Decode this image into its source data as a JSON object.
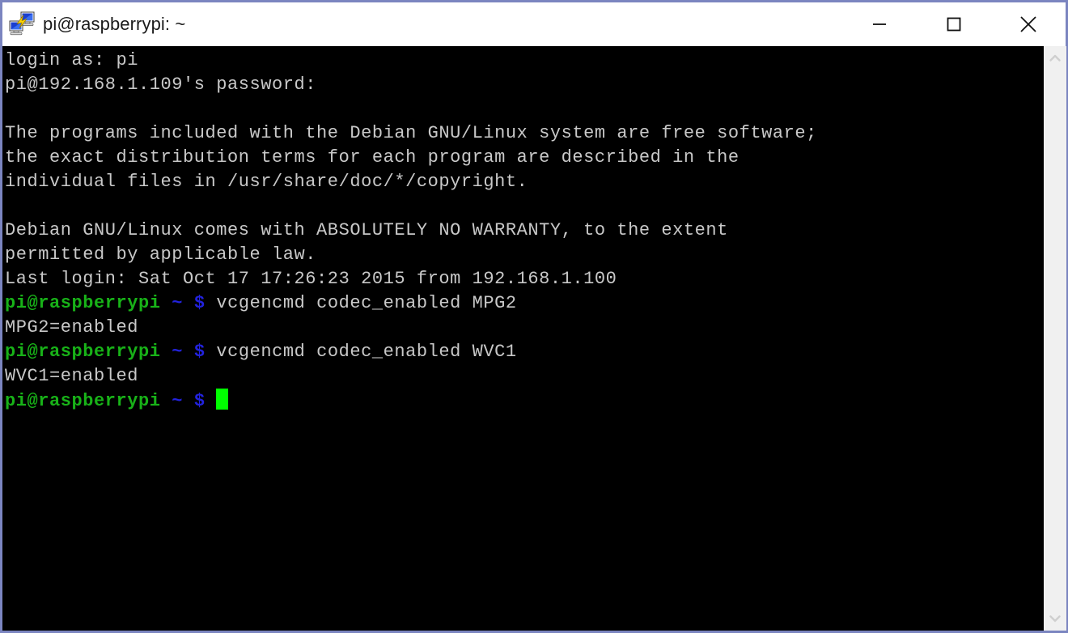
{
  "window": {
    "title": "pi@raspberrypi: ~",
    "icon": "putty-icon",
    "border_color": "#7b85c0",
    "titlebar_bg": "#ffffff",
    "controls": {
      "minimize_label": "Minimize",
      "maximize_label": "Maximize",
      "close_label": "Close"
    }
  },
  "terminal": {
    "background": "#000000",
    "foreground": "#c8c8c8",
    "prompt_user_color": "#18b218",
    "prompt_symbol_color": "#2222dd",
    "cursor_color": "#00ff00",
    "prompt_user": "pi@raspberrypi",
    "prompt_tilde": "~",
    "prompt_dollar": "$",
    "lines": [
      {
        "type": "text",
        "text": "login as: pi"
      },
      {
        "type": "text",
        "text": "pi@192.168.1.109's password:"
      },
      {
        "type": "blank",
        "text": ""
      },
      {
        "type": "text",
        "text": "The programs included with the Debian GNU/Linux system are free software;"
      },
      {
        "type": "text",
        "text": "the exact distribution terms for each program are described in the"
      },
      {
        "type": "text",
        "text": "individual files in /usr/share/doc/*/copyright."
      },
      {
        "type": "blank",
        "text": ""
      },
      {
        "type": "text",
        "text": "Debian GNU/Linux comes with ABSOLUTELY NO WARRANTY, to the extent"
      },
      {
        "type": "text",
        "text": "permitted by applicable law."
      },
      {
        "type": "text",
        "text": "Last login: Sat Oct 17 17:26:23 2015 from 192.168.1.100"
      },
      {
        "type": "prompt",
        "command": "vcgencmd codec_enabled MPG2"
      },
      {
        "type": "text",
        "text": "MPG2=enabled"
      },
      {
        "type": "prompt",
        "command": "vcgencmd codec_enabled WVC1"
      },
      {
        "type": "text",
        "text": "WVC1=enabled"
      },
      {
        "type": "prompt-cursor",
        "command": ""
      }
    ]
  },
  "scrollbar": {
    "up_icon": "chevron-up-icon",
    "down_icon": "chevron-down-icon",
    "track_color": "#f0f0f0",
    "arrow_color": "#d0d0d0"
  }
}
